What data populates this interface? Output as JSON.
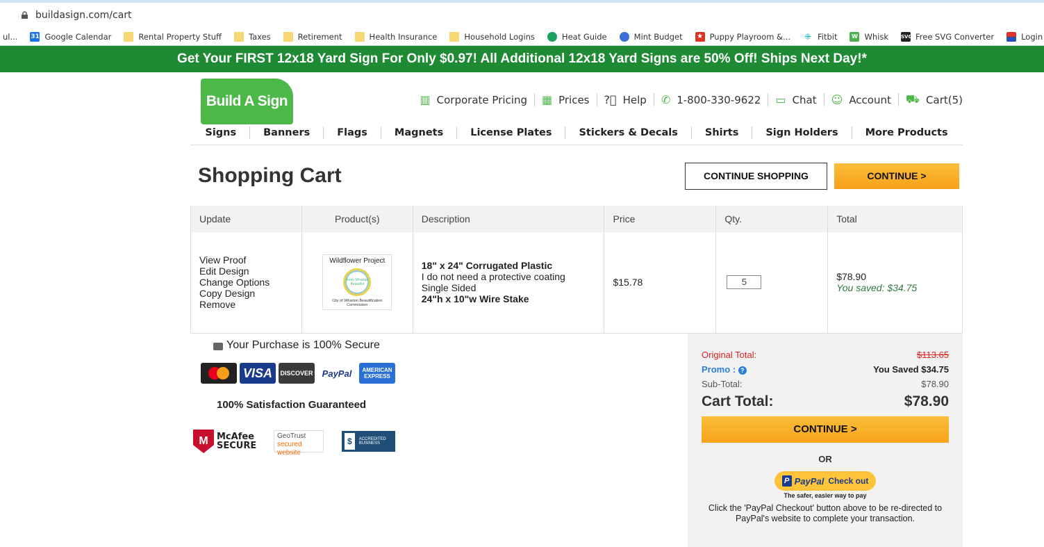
{
  "browser": {
    "url": "buildasign.com/cart",
    "bookmarks": [
      {
        "label": "ul...",
        "icon": "none"
      },
      {
        "label": "Google Calendar",
        "icon": "calendar-icon"
      },
      {
        "label": "Rental Property Stuff",
        "icon": "folder-icon"
      },
      {
        "label": "Taxes",
        "icon": "folder-icon"
      },
      {
        "label": "Retirement",
        "icon": "folder-icon"
      },
      {
        "label": "Health Insurance",
        "icon": "folder-icon"
      },
      {
        "label": "Household Logins",
        "icon": "folder-icon"
      },
      {
        "label": "Heat Guide",
        "icon": "green-dot-icon"
      },
      {
        "label": "Mint Budget",
        "icon": "blue-dot-icon"
      },
      {
        "label": "Puppy Playroom &...",
        "icon": "star-icon"
      },
      {
        "label": "Fitbit",
        "icon": "fitbit-icon"
      },
      {
        "label": "Whisk",
        "icon": "whisk-icon"
      },
      {
        "label": "Free SVG Converter",
        "icon": "svg-icon"
      },
      {
        "label": "Login | TxTagS",
        "icon": "flag-icon"
      }
    ]
  },
  "promo_banner": "Get Your FIRST 12x18 Yard Sign For Only $0.97! All Additional 12x18 Yard Signs are 50% Off! Ships Next Day!*",
  "header": {
    "logo": "Build A Sign",
    "links": {
      "corporate": "Corporate Pricing",
      "prices": "Prices",
      "help": "Help",
      "phone": "1-800-330-9622",
      "chat": "Chat",
      "account": "Account",
      "cart": "Cart(5)"
    },
    "nav": [
      "Signs",
      "Banners",
      "Flags",
      "Magnets",
      "License Plates",
      "Stickers & Decals",
      "Shirts",
      "Sign Holders",
      "More Products"
    ]
  },
  "page": {
    "title": "Shopping Cart",
    "continue_shopping": "CONTINUE SHOPPING",
    "continue": "CONTINUE >"
  },
  "cart_table": {
    "headers": {
      "update": "Update",
      "products": "Product(s)",
      "description": "Description",
      "price": "Price",
      "qty": "Qty.",
      "total": "Total"
    },
    "item": {
      "actions": [
        "View Proof",
        "Edit Design",
        "Change Options",
        "Copy Design",
        "Remove"
      ],
      "thumb_title": "Wildflower Project",
      "thumb_caption": "City of Wharton Beautification Commission",
      "thumb_center": "Keep Wharton Beautiful",
      "desc_main": "18\" x 24\"   Corrugated Plastic",
      "desc_coating": "I do not need a protective coating",
      "desc_sided": "Single Sided",
      "desc_stake": "24\"h x 10\"w Wire Stake",
      "price": "$15.78",
      "qty": "5",
      "total": "$78.90",
      "saved": "You saved: $34.75"
    }
  },
  "trust": {
    "secure": "Your Purchase is 100% Secure",
    "cards": {
      "visa": "VISA",
      "discover": "DISCOVER",
      "paypal": "PayPal",
      "amex": "AMERICAN EXPRESS"
    },
    "satisfaction": "100% Satisfaction Guaranteed",
    "mcafee": "McAfee SECURE",
    "geotrust_1": "GeoTrust",
    "geotrust_2": "secured website",
    "bbb": "ACCREDITED BUSINESS"
  },
  "summary": {
    "original_label": "Original Total:",
    "original_value": "$113.65",
    "promo_label": "Promo :",
    "promo_value": "You Saved $34.75",
    "subtotal_label": "Sub-Total:",
    "subtotal_value": "$78.90",
    "total_label": "Cart Total:",
    "total_value": "$78.90",
    "continue": "CONTINUE >",
    "or": "OR",
    "paypal_checkout": "Check out",
    "paypal_brand": "PayPal",
    "safer": "The safer, easier way to pay",
    "note": "Click the 'PayPal Checkout' button above to be re-directed to PayPal's website to complete your transaction."
  },
  "colors": {
    "brand_green": "#4cb848",
    "banner_green": "#1e8a34",
    "button_orange": "#f7a21a"
  }
}
